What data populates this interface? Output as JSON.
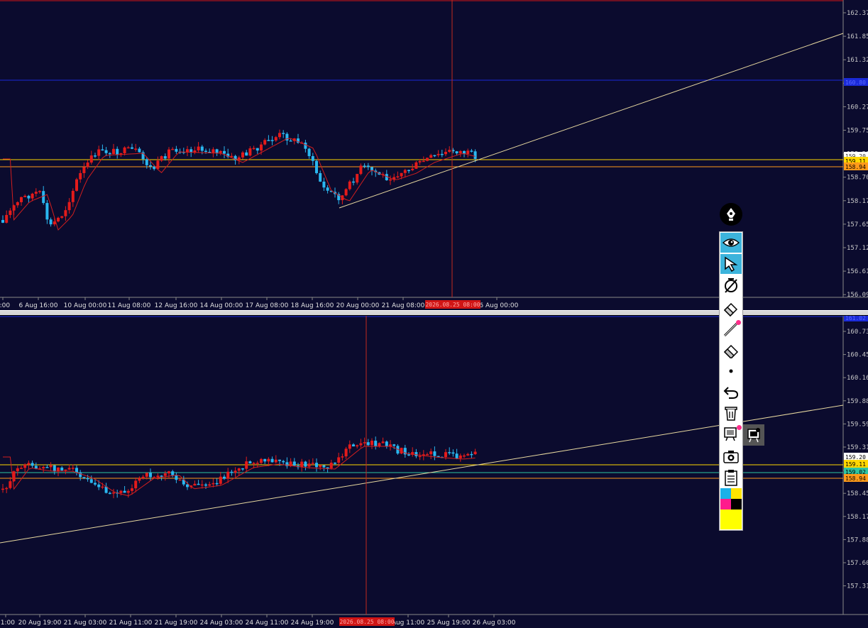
{
  "top_chart": {
    "price_ticks": [
      "162.37",
      "161.85",
      "161.32",
      "160.80",
      "160.27",
      "159.75",
      "159.20",
      "158.70",
      "158.17",
      "157.65",
      "157.12",
      "156.61",
      "156.09"
    ],
    "time_ticks": [
      "8:00",
      "6 Aug 16:00",
      "10 Aug 00:00",
      "11 Aug 08:00",
      "12 Aug 16:00",
      "14 Aug 00:00",
      "17 Aug 08:00",
      "18 Aug 16:00",
      "20 Aug 00:00",
      "21 Aug 08:00",
      "26 Aug 00:00"
    ],
    "crosshair_time": "2026.08.25 08:00",
    "tags": {
      "blue": "160.80",
      "yellow": "159.11",
      "orange": "158.94",
      "hidden": "159.20"
    }
  },
  "bottom_chart": {
    "price_ticks": [
      "160.73",
      "160.45",
      "160.16",
      "159.88",
      "159.59",
      "159.31",
      "158.74",
      "158.45",
      "158.17",
      "157.88",
      "157.60",
      "157.31"
    ],
    "time_ticks": [
      "11:00",
      "20 Aug 19:00",
      "21 Aug 03:00",
      "21 Aug 11:00",
      "21 Aug 19:00",
      "24 Aug 03:00",
      "24 Aug 11:00",
      "24 Aug 19:00",
      "Aug 11:00",
      "25 Aug 19:00",
      "26 Aug 03:00"
    ],
    "crosshair_time": "2026.08.25 08:00",
    "tags": {
      "blue_top": "161.02",
      "current": "159.20",
      "yellow": "159.11",
      "teal": "159.02",
      "orange": "158.94"
    }
  },
  "colors": {
    "background": "#0b0b2e",
    "bull": "#e41b1b",
    "bear": "#2ab7f0",
    "moving_average": "#d21e1e",
    "trendline": "#e8d9a0",
    "crosshair": "#c0281e",
    "level_yellow": "#ffd700",
    "level_orange": "#ff9a1a",
    "level_blue": "#1a2ad8",
    "level_teal": "#2ec4a2",
    "toolbar_active": "#3cb4dc"
  },
  "toolbar": {
    "tools": [
      "pen-icon",
      "eye-icon",
      "cursor-icon",
      "no-magnet-icon",
      "pencil-eraser-icon",
      "line-icon",
      "eraser-icon",
      "dot-icon",
      "undo-icon",
      "trash-icon",
      "screen-icon",
      "camera-icon",
      "clipboard-icon"
    ],
    "swatches": [
      "#1ab0e8",
      "#ffe400",
      "#ff1a8c",
      "#000000",
      "#ffff00"
    ]
  }
}
